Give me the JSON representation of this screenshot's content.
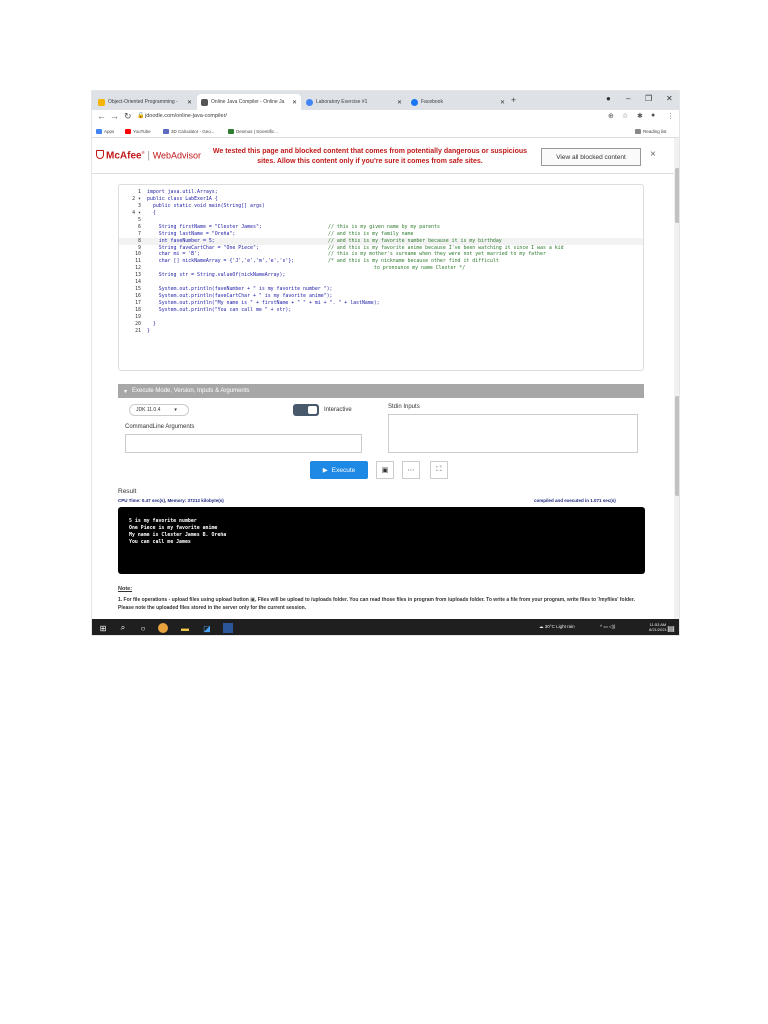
{
  "browser": {
    "tabs": [
      {
        "label": "Object-Oriented Programming - ",
        "active": false,
        "color": "#f4b400"
      },
      {
        "label": "Online Java Compiler - Online Ja",
        "active": true,
        "color": "#555555"
      },
      {
        "label": "Laboratory Exercise #1",
        "active": false,
        "color": "#4285f4"
      },
      {
        "label": "Facebook",
        "active": false,
        "color": "#1877f2"
      }
    ],
    "url": "jdoodle.com/online-java-compiler/",
    "bookmarks": [
      {
        "label": "Apps",
        "color": "#4285f4"
      },
      {
        "label": "YouTube",
        "color": "#ff0000"
      },
      {
        "label": "3D Calculator - Geo...",
        "color": "#5c6bc0"
      },
      {
        "label": "Desmos | Scientific...",
        "color": "#2e7d32"
      }
    ],
    "reading_list": "Reading list"
  },
  "mcafee": {
    "brand": "McAfee",
    "product": "WebAdvisor",
    "message": "We tested this page and blocked content that comes from potentially dangerous or suspicious sites. Allow this content only if you're sure it comes from safe sites.",
    "button": "View all blocked content",
    "close": "×"
  },
  "editor": {
    "lines": [
      {
        "n": "1",
        "code": "import java.util.Arrays;",
        "comment": "",
        "hl": false
      },
      {
        "n": "2 ▾",
        "code": "public class LabExer1A {",
        "comment": "",
        "hl": false
      },
      {
        "n": "3",
        "code": "  public static void main(String[] args)",
        "comment": "",
        "hl": false
      },
      {
        "n": "4 ▾",
        "code": "  {",
        "comment": "",
        "hl": false
      },
      {
        "n": "5",
        "code": "",
        "comment": "",
        "hl": false
      },
      {
        "n": "6",
        "code": "    String firstName = \"Clester James\";",
        "comment": "// this is my given name by my parents",
        "hl": false
      },
      {
        "n": "7",
        "code": "    String lastName = \"Oreña\";",
        "comment": "// and this is my family name",
        "hl": false
      },
      {
        "n": "8",
        "code": "    int faveNumber = 5;",
        "comment": "// and this is my favorite number because it is my birthday",
        "hl": true
      },
      {
        "n": "9",
        "code": "    String faveCartChar = \"One Piece\";",
        "comment": "// and this is my favorite anime because I've been watching it since I was a kid",
        "hl": false
      },
      {
        "n": "10",
        "code": "    char mi = 'B';",
        "comment": "// this is my mother's surname when they were not yet married to my father",
        "hl": false
      },
      {
        "n": "11",
        "code": "    char [] nickNameArray = {'J','e','m','e','s'};",
        "comment": "/* and this is my nickname because other find it difficult",
        "hl": false
      },
      {
        "n": "12",
        "code": "",
        "comment": "  to pronounce my name Clester */",
        "hl": false,
        "wide": true
      },
      {
        "n": "13",
        "code": "    String str = String.valueOf(nickNameArray);",
        "comment": "",
        "hl": false
      },
      {
        "n": "14",
        "code": "",
        "comment": "",
        "hl": false
      },
      {
        "n": "15",
        "code": "    System.out.println(faveNumber + \" is my favorite number \");",
        "comment": "",
        "hl": false
      },
      {
        "n": "16",
        "code": "    System.out.println(faveCartChar + \" is my favorite anime\");",
        "comment": "",
        "hl": false
      },
      {
        "n": "17",
        "code": "    System.out.println(\"My name is \" + firstName + \" \" + mi + \". \" + lastName);",
        "comment": "",
        "hl": false
      },
      {
        "n": "18",
        "code": "    System.out.println(\"You can call me \" + str);",
        "comment": "",
        "hl": false
      },
      {
        "n": "19",
        "code": "",
        "comment": "",
        "hl": false
      },
      {
        "n": "20",
        "code": "  }",
        "comment": "",
        "hl": false
      },
      {
        "n": "21",
        "code": "}",
        "comment": "",
        "hl": false
      }
    ]
  },
  "execute": {
    "header": "Execute Mode, Version, Inputs & Arguments",
    "jdk": "JDK 11.0.4",
    "interactive": "Interactive",
    "stdin_label": "Stdin Inputs",
    "cmd_label": "CommandLine Arguments",
    "execute_btn": "Execute"
  },
  "result": {
    "title": "Result",
    "cpu": "CPU Time: 0.47 sec(s), Memory: 37212 kilobyte(s)",
    "status": "compiled and executed in 1.071 sec(s)",
    "output": [
      "5 is my favorite number",
      "One Piece is my favorite anime",
      "My name is Clester James B. Oreña",
      "You can call me James"
    ]
  },
  "note": {
    "title": "Note:",
    "text": "1. For file operations - upload files using upload button ▣, Files will be upload to /uploads folder. You can read those files in program from /uploads folder. To write a file from your program, write files to '/myfiles' folder. Please note the uploaded files stored in the server only for the current session."
  },
  "taskbar": {
    "weather": "30°C  Light rain",
    "time": "11:53 AM",
    "date": "8/21/2021"
  }
}
